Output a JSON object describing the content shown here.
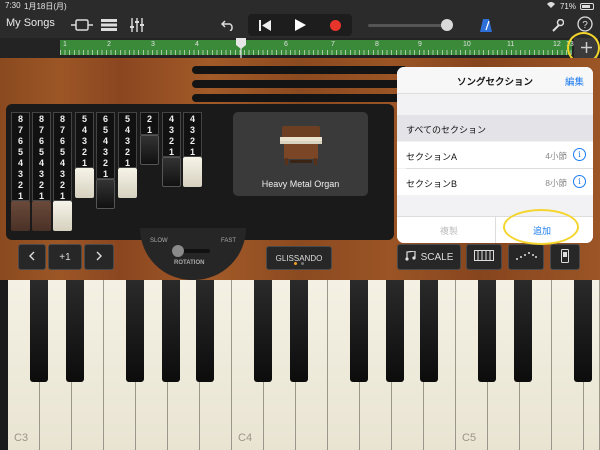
{
  "status": {
    "time": "7:30",
    "date": "1月18日(月)",
    "battery": "71%"
  },
  "toolbar": {
    "my_songs": "My Songs"
  },
  "ruler": {
    "numbers": [
      "1",
      "2",
      "3",
      "4",
      "5",
      "6",
      "7",
      "8",
      "9",
      "10",
      "11",
      "12",
      "13"
    ]
  },
  "drawbars": [
    {
      "numbers": [
        "8",
        "7",
        "6",
        "5",
        "4",
        "3",
        "2",
        "1"
      ],
      "cap": "brown"
    },
    {
      "numbers": [
        "8",
        "7",
        "6",
        "5",
        "4",
        "3",
        "2",
        "1"
      ],
      "cap": "brown"
    },
    {
      "numbers": [
        "8",
        "7",
        "6",
        "5",
        "4",
        "3",
        "2",
        "1"
      ],
      "cap": "white"
    },
    {
      "numbers": [
        "5",
        "4",
        "3",
        "2",
        "1"
      ],
      "cap": "white"
    },
    {
      "numbers": [
        "6",
        "5",
        "4",
        "3",
        "2",
        "1"
      ],
      "cap": "black"
    },
    {
      "numbers": [
        "5",
        "4",
        "3",
        "2",
        "1"
      ],
      "cap": "white"
    },
    {
      "numbers": [
        "2",
        "1"
      ],
      "cap": "black"
    },
    {
      "numbers": [
        "4",
        "3",
        "2",
        "1"
      ],
      "cap": "black"
    },
    {
      "numbers": [
        "4",
        "3",
        "2",
        "1"
      ],
      "cap": "white"
    }
  ],
  "instrument": {
    "name": "Heavy Metal Organ"
  },
  "controls": {
    "octave_label": "+1",
    "rotation_label": "ROTATION",
    "slow_label": "SLOW",
    "fast_label": "FAST",
    "glissando_label": "GLISSANDO",
    "scale_label": "SCALE"
  },
  "keyboard": {
    "note_labels": [
      "C3",
      "C4",
      "C5"
    ]
  },
  "popover": {
    "title": "ソングセクション",
    "edit": "編集",
    "all_sections": "すべてのセクション",
    "sections": [
      {
        "name": "セクションA",
        "length": "4小節"
      },
      {
        "name": "セクションB",
        "length": "8小節"
      }
    ],
    "duplicate": "複製",
    "add": "追加"
  },
  "colors": {
    "accent": "#1a7bf2",
    "record": "#e8352b",
    "ruler": "#3a8a3a",
    "callout": "#f4d52b"
  }
}
